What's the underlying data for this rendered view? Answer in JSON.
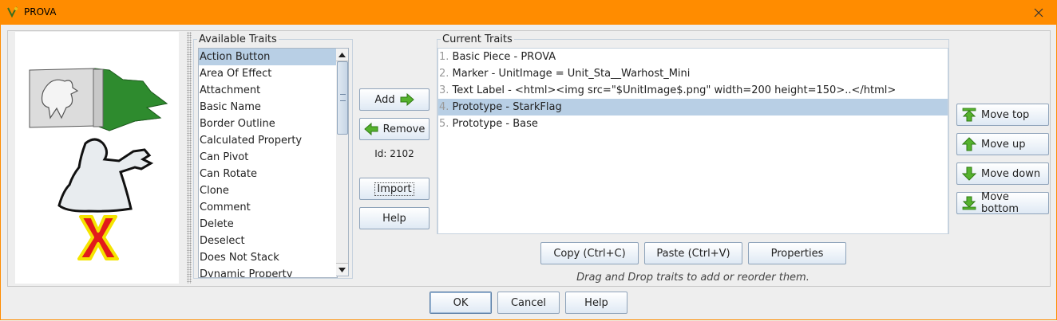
{
  "window": {
    "title": "PROVA"
  },
  "available_traits": {
    "legend": "Available Traits",
    "items": [
      "Action Button",
      "Area Of Effect",
      "Attachment",
      "Basic Name",
      "Border Outline",
      "Calculated Property",
      "Can Pivot",
      "Can Rotate",
      "Clone",
      "Comment",
      "Delete",
      "Deselect",
      "Does Not Stack",
      "Dynamic Property"
    ],
    "selected_index": 0
  },
  "middle": {
    "add_label": "Add",
    "remove_label": "Remove",
    "id_text": "Id: 2102",
    "import_label": "Import",
    "help_label": "Help"
  },
  "current_traits": {
    "legend": "Current Traits",
    "items": [
      {
        "num": "1.",
        "text": "Basic Piece - PROVA"
      },
      {
        "num": "2.",
        "text": "Marker - UnitImage = Unit_Sta__Warhost_Mini"
      },
      {
        "num": "3.",
        "text": "Text Label - <html><img src=\"$UnitImage$.png\" width=200 height=150>..</html>"
      },
      {
        "num": "4.",
        "text": "Prototype - StarkFlag"
      },
      {
        "num": "5.",
        "text": "Prototype - Base"
      }
    ],
    "selected_index": 3
  },
  "move_buttons": {
    "top": "Move top",
    "up": "Move up",
    "down": "Move down",
    "bottom": "Move bottom"
  },
  "clipboard": {
    "copy": "Copy (Ctrl+C)",
    "paste": "Paste (Ctrl+V)",
    "properties": "Properties"
  },
  "hint": "Drag and Drop traits to add or reorder them.",
  "footer": {
    "ok": "OK",
    "cancel": "Cancel",
    "help": "Help"
  },
  "icons": {
    "app": "vassal-icon",
    "close": "close-icon",
    "add_arrow": "arrow-right-icon",
    "remove_arrow": "arrow-left-icon",
    "move_top": "arrow-top-icon",
    "move_up": "arrow-up-icon",
    "move_down": "arrow-down-icon",
    "move_bottom": "arrow-bottom-icon"
  },
  "colors": {
    "title_bar": "#ff8c00",
    "selection": "#b8cfe5",
    "arrow_green": "#4caf2a"
  }
}
